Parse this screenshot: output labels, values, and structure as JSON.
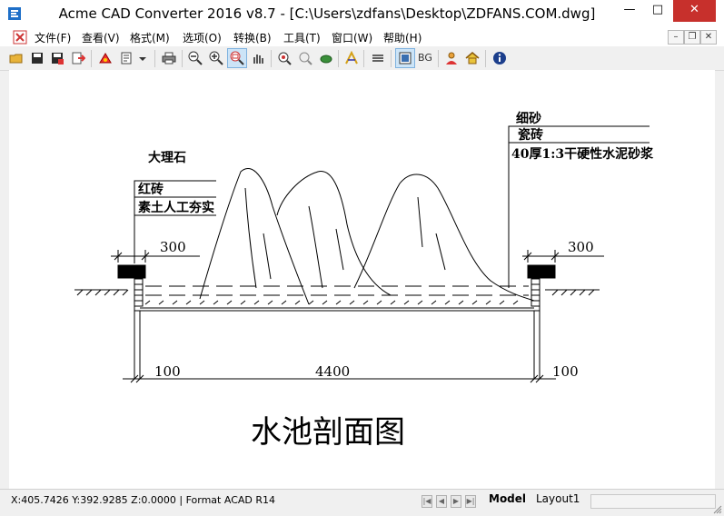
{
  "window": {
    "title": "Acme CAD Converter 2016 v8.7 - [C:\\Users\\zdfans\\Desktop\\ZDFANS.COM.dwg]",
    "minimize": "—",
    "maximize": "□",
    "close": "✕"
  },
  "menu": {
    "items": [
      "文件(F)",
      "查看(V)",
      "格式(M)",
      "选项(O)",
      "转换(B)",
      "工具(T)",
      "窗口(W)",
      "帮助(H)"
    ],
    "mdi_minimize": "–",
    "mdi_restore": "❐",
    "mdi_close": "✕"
  },
  "toolbar": {
    "bg_label": "BG",
    "icons": [
      "open-icon",
      "save-icon",
      "save-as-icon",
      "export-icon",
      "convert-icon",
      "batch-icon",
      "dropdown-icon",
      "print-icon",
      "zoom-out-icon",
      "zoom-in-icon",
      "zoom-window-icon",
      "pan-icon",
      "zoom-extents-icon",
      "zoom-previous-icon",
      "layer-icon",
      "measure-icon",
      "layers-icon",
      "display-icon",
      "bg-icon",
      "user-icon",
      "home-icon",
      "info-icon"
    ]
  },
  "drawing": {
    "title": "水池剖面图",
    "left_layers": [
      "大理石",
      "红砖",
      "素土人工夯实"
    ],
    "right_layers": [
      "细砂",
      "瓷砖",
      "40厚1:3干硬性水泥砂浆"
    ],
    "dim_top_left": "300",
    "dim_top_right": "300",
    "dim_bottom_left": "100",
    "dim_bottom_mid": "4400",
    "dim_bottom_right": "100"
  },
  "status": {
    "coords": "X:405.7426 Y:392.9285 Z:0.0000 | Format ACAD R14",
    "nav": [
      "|◀",
      "◀",
      "▶",
      "▶|"
    ],
    "tabs": [
      "Model",
      "Layout1"
    ]
  },
  "colors": {
    "accent": "#cce4f7",
    "titlebar": "#ffffff",
    "app_icon": "#1e6fc8"
  }
}
